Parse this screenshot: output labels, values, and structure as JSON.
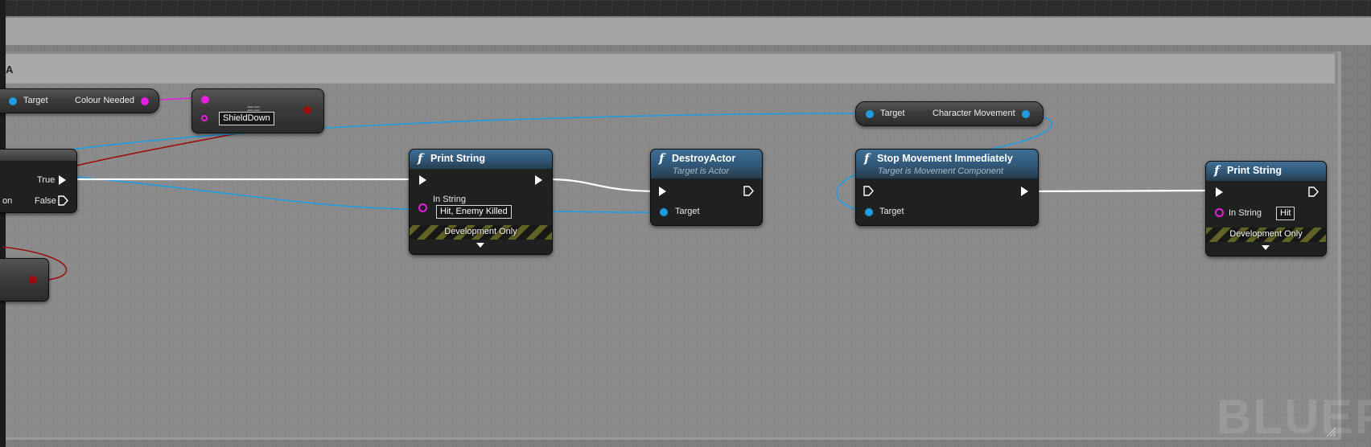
{
  "comment": {
    "title_fragment": "A"
  },
  "nodes": {
    "get_colour": {
      "target_label": "Target",
      "output_label": "Colour Needed"
    },
    "equal": {
      "symbol": "==",
      "enum_value": "ShieldDown"
    },
    "branch": {
      "true_label": "True",
      "false_label_fragment": "on",
      "false_label": "False"
    },
    "print_string_1": {
      "icon": "f",
      "title": "Print String",
      "instring_label": "In String",
      "instring_value": "Hit, Enemy Killed",
      "dev_only": "Development Only"
    },
    "destroy_actor": {
      "icon": "f",
      "title": "DestroyActor",
      "subtitle": "Target is Actor",
      "target_label": "Target"
    },
    "get_char_movement": {
      "target_label": "Target",
      "output_label": "Character Movement"
    },
    "stop_movement": {
      "icon": "f",
      "title": "Stop Movement Immediately",
      "subtitle": "Target is Movement Component",
      "target_label": "Target"
    },
    "print_string_2": {
      "icon": "f",
      "title": "Print String",
      "instring_label": "In String",
      "instring_value": "Hit",
      "dev_only": "Development Only"
    }
  },
  "watermark": "BLUEP",
  "colors": {
    "exec": "#ffffff",
    "object": "#1f9ce0",
    "enum": "#e61ee0",
    "bool": "#9c0e0e"
  }
}
